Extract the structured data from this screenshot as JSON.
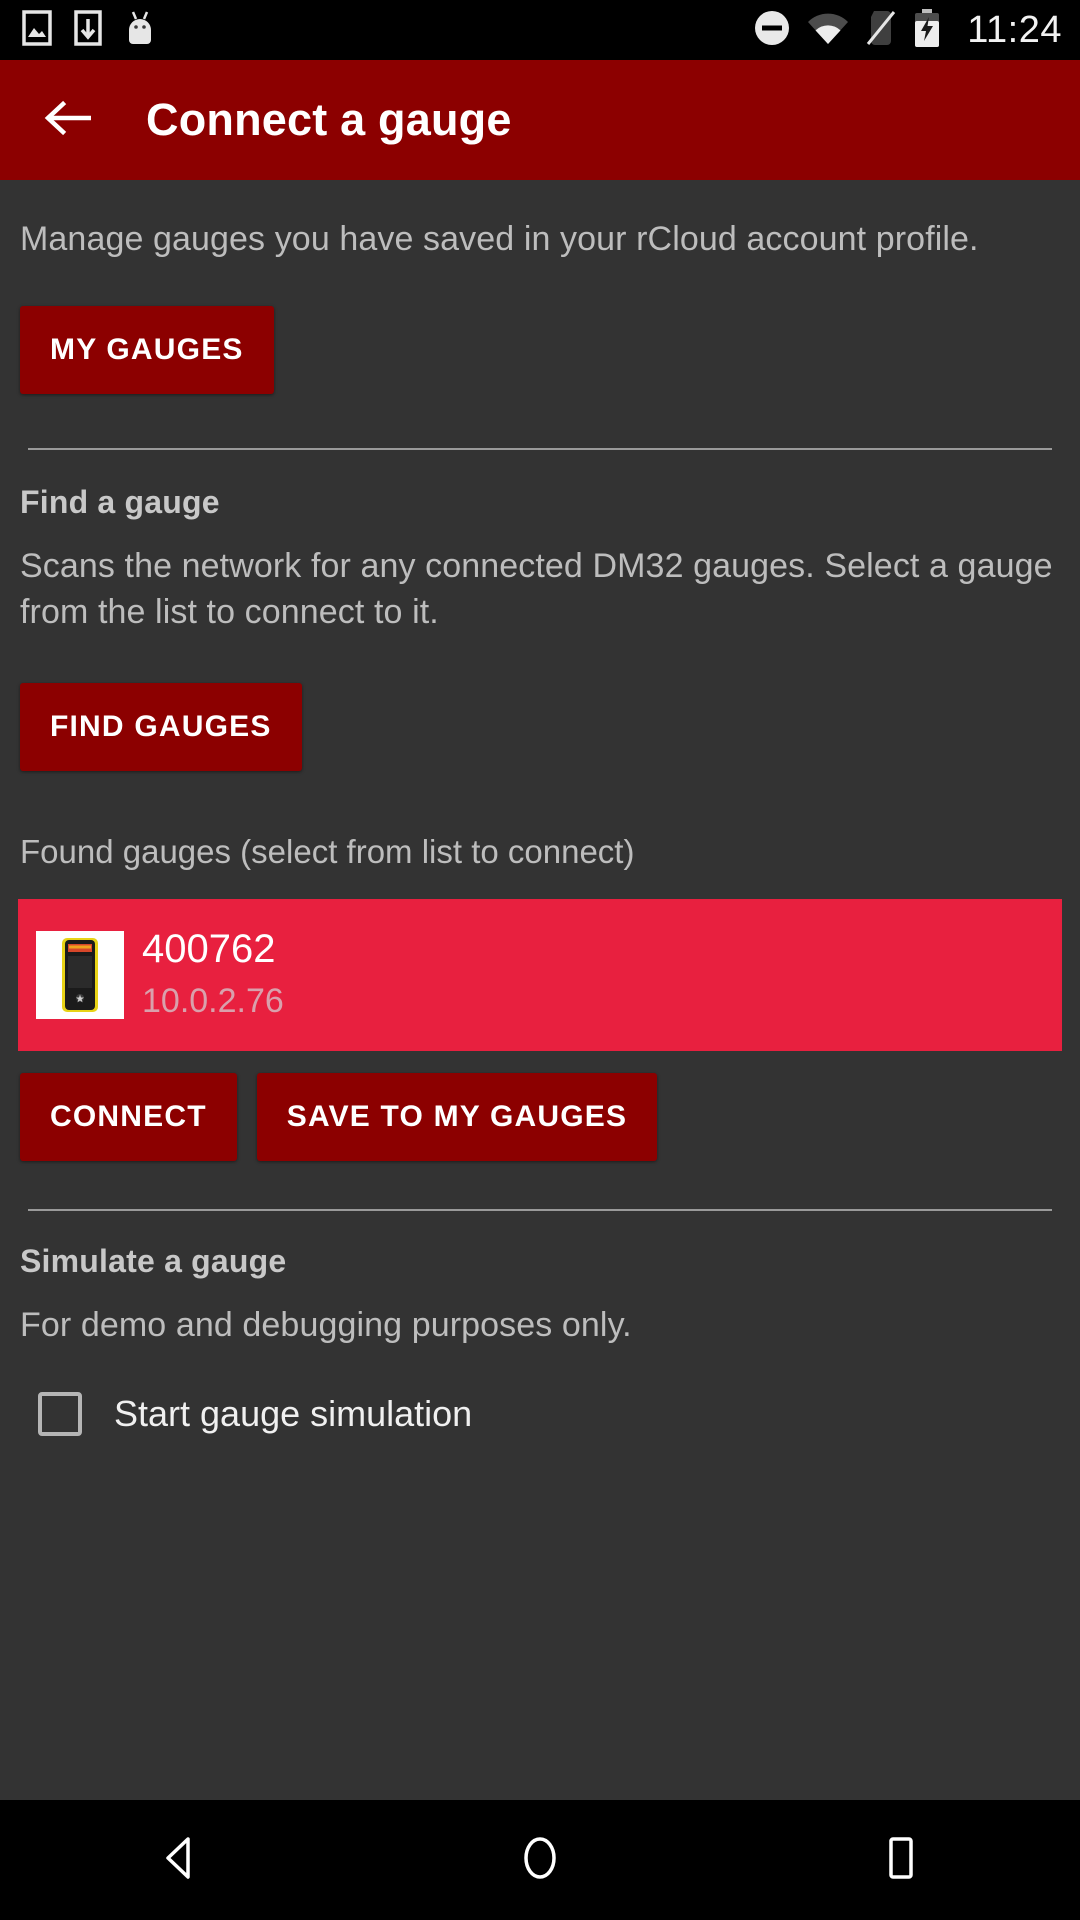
{
  "status_bar": {
    "time": "11:24",
    "left_icons": [
      "image-icon",
      "download-icon",
      "android-icon"
    ],
    "right_icons": [
      "do-not-disturb-icon",
      "wifi-icon",
      "no-sim-icon",
      "battery-charging-icon"
    ]
  },
  "appbar": {
    "back_icon": "back-arrow-icon",
    "title": "Connect a gauge",
    "background_color": "#8C0000"
  },
  "main": {
    "intro_text": "Manage gauges you have saved in your rCloud account profile.",
    "my_gauges_button": "MY GAUGES",
    "find_section": {
      "heading": "Find a gauge",
      "description": "Scans the network for any connected DM32 gauges. Select a gauge from the list to connect to it.",
      "find_button": "FIND GAUGES"
    },
    "found_list": {
      "label": "Found gauges (select from list to connect)",
      "items": [
        {
          "name": "400762",
          "ip": "10.0.2.76",
          "selected": true,
          "thumbnail": "gauge-device-thumbnail"
        }
      ],
      "selected_color": "#E8203F"
    },
    "actions": {
      "connect_button": "CONNECT",
      "save_button": "SAVE TO MY GAUGES"
    },
    "simulate_section": {
      "heading": "Simulate a gauge",
      "description": "For demo and debugging purposes only.",
      "checkbox_label": "Start gauge simulation",
      "checkbox_checked": false
    }
  },
  "navbar": {
    "back": "nav-back-icon",
    "home": "nav-home-icon",
    "recents": "nav-recents-icon"
  }
}
